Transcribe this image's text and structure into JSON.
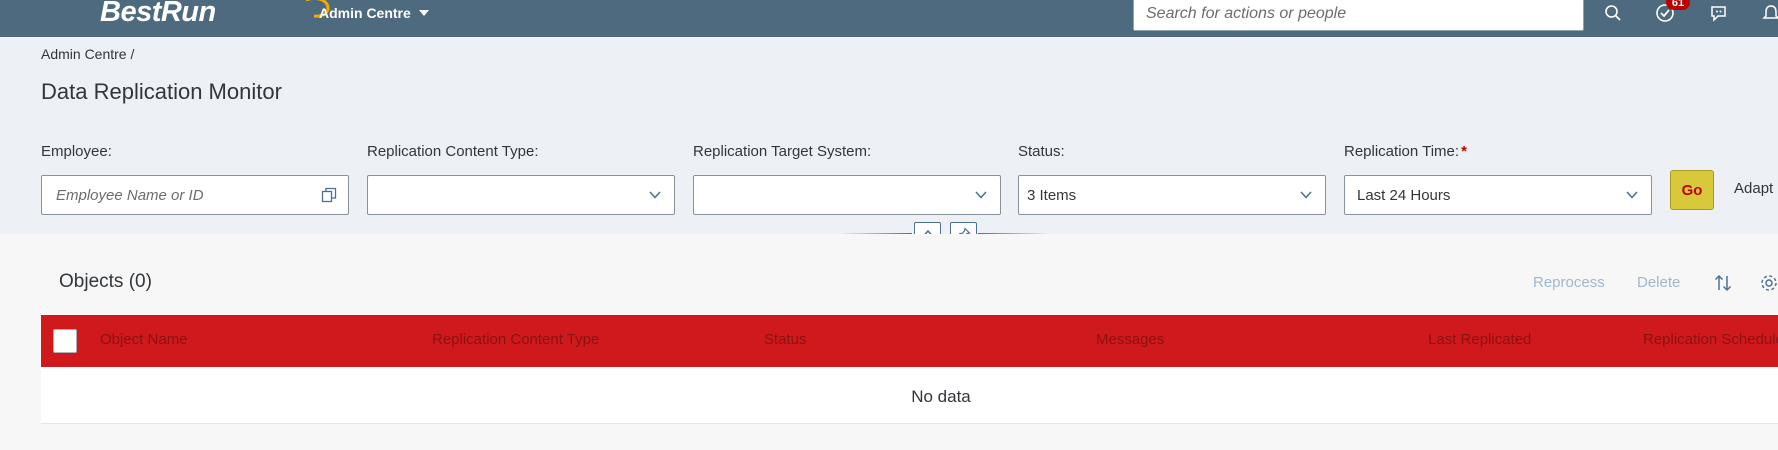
{
  "shell": {
    "brand": "BestRun",
    "menu_label": "Admin Centre",
    "search_placeholder": "Search for actions or people",
    "notification_count": "61"
  },
  "breadcrumb": {
    "root": "Admin Centre",
    "separator": "/"
  },
  "page_title": "Data Replication Monitor",
  "filters": {
    "employee": {
      "label": "Employee:",
      "placeholder": "Employee Name or ID"
    },
    "content_type": {
      "label": "Replication Content Type:",
      "value": ""
    },
    "target_system": {
      "label": "Replication Target System:",
      "value": ""
    },
    "status": {
      "label": "Status:",
      "value": "3 Items"
    },
    "replication_time": {
      "label": "Replication Time:",
      "required_mark": "*",
      "value": "Last 24 Hours"
    }
  },
  "actions": {
    "go": "Go",
    "adapt": "Adapt"
  },
  "table": {
    "title": "Objects (0)",
    "toolbar": {
      "reprocess": "Reprocess",
      "delete": "Delete"
    },
    "columns": [
      "Object Name",
      "Replication Content Type",
      "Status",
      "Messages",
      "Last Replicated",
      "Replication Schedule"
    ],
    "empty_text": "No data"
  },
  "colors": {
    "shell_bg": "#4e6a7e",
    "header_bg": "#edf1f5",
    "table_header_bg": "#d0191d",
    "go_button_bg": "#d8c93c",
    "go_button_text": "#c10000",
    "toolbar_link_disabled": "#9fb7cd",
    "required_mark": "#bb0000"
  },
  "icons": {
    "search": "search-icon",
    "tasks": "check-circle-icon",
    "feedback": "feedback-icon",
    "notifications": "bell-icon",
    "value_help": "value-help-icon",
    "dropdown": "chevron-down-icon",
    "collapse": "chevron-up-icon",
    "pin": "pin-icon",
    "sort": "sort-icon",
    "settings": "gear-icon"
  }
}
